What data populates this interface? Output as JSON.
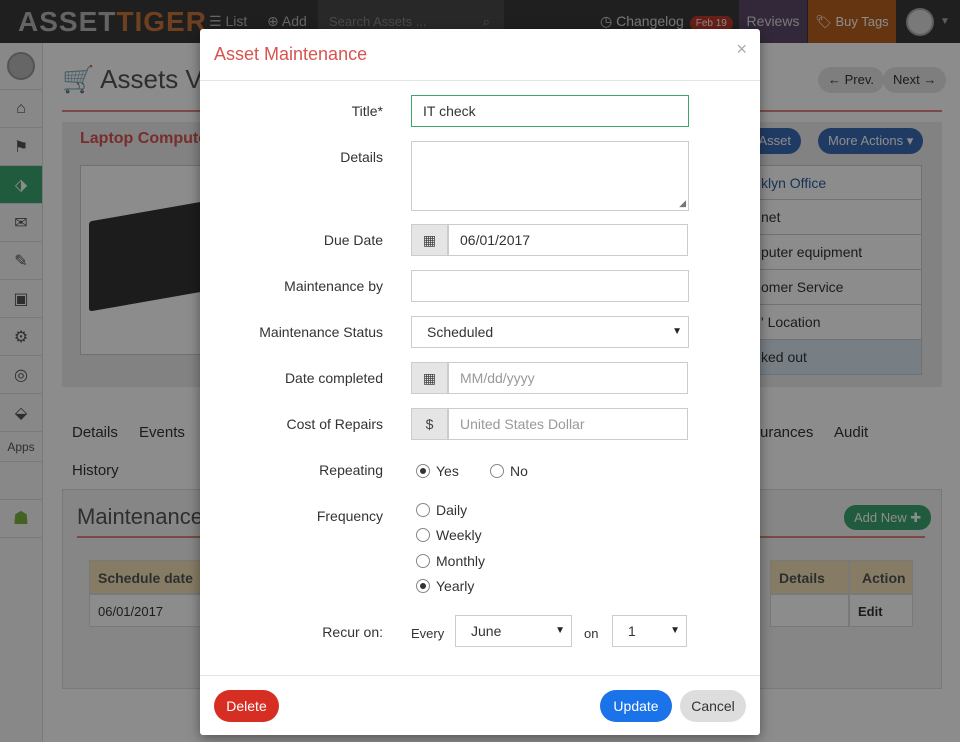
{
  "topbar": {
    "logo_a": "ASSET",
    "logo_b": "TIGER",
    "list": "List",
    "add": "Add",
    "search_placeholder": "Search Assets ...",
    "changelog": "Changelog",
    "changelog_badge": "Feb 19",
    "reviews": "Reviews",
    "buy_tags": "Buy Tags"
  },
  "sidebar": {
    "apps_label": "Apps"
  },
  "background": {
    "page_title": "Assets Vie",
    "prev": "Prev.",
    "next": "Next",
    "asset_title": "Laptop Compute",
    "edit_asset": "t Asset",
    "more_actions": "More Actions",
    "info_rows": [
      "klyn Office",
      "net",
      "puter equipment",
      "omer Service",
      "' Location",
      "ked out"
    ],
    "tabs": {
      "details": "Details",
      "events": "Events",
      "insurances": "urances",
      "audit": "Audit",
      "history": "History"
    },
    "maintenance_title": "Maintenance",
    "add_new": "Add New",
    "table": {
      "headers": {
        "schedule_date": "Schedule date",
        "details": "Details",
        "action": "Action"
      },
      "row": {
        "schedule_date": "06/01/2017",
        "action": "Edit"
      }
    }
  },
  "modal": {
    "title": "Asset Maintenance",
    "close": "×",
    "labels": {
      "title": "Title*",
      "details": "Details",
      "due_date": "Due Date",
      "maintenance_by": "Maintenance by",
      "maintenance_status": "Maintenance Status",
      "date_completed": "Date completed",
      "cost_of_repairs": "Cost of Repairs",
      "repeating": "Repeating",
      "frequency": "Frequency",
      "recur_on": "Recur on:"
    },
    "values": {
      "title": "IT check",
      "details": "",
      "due_date": "06/01/2017",
      "maintenance_by": "",
      "maintenance_status": "Scheduled",
      "date_completed_placeholder": "MM/dd/yyyy",
      "currency_symbol": "$",
      "cost_placeholder": "United States Dollar"
    },
    "repeating": {
      "yes": "Yes",
      "no": "No",
      "selected": "yes"
    },
    "frequency": {
      "options": [
        "Daily",
        "Weekly",
        "Monthly",
        "Yearly"
      ],
      "selected": "Yearly"
    },
    "recur": {
      "every": "Every",
      "month": "June",
      "on": "on",
      "day": "1"
    },
    "buttons": {
      "delete": "Delete",
      "update": "Update",
      "cancel": "Cancel"
    }
  },
  "colors": {
    "accent_red": "#d9534f",
    "delete": "#d62e22",
    "update": "#1a73e8",
    "success": "#3aa76d"
  }
}
